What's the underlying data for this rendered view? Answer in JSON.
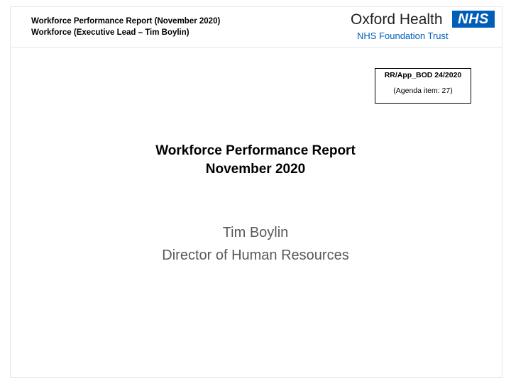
{
  "header": {
    "line1": "Workforce Performance Report (November 2020)",
    "line2": "Workforce (Executive Lead – Tim Boylin)"
  },
  "logo": {
    "organisation": "Oxford Health",
    "nhs_mark": "NHS",
    "trust": "NHS Foundation Trust",
    "brand_color": "#005eb8"
  },
  "reference": {
    "code": "RR/App_BOD 24/2020",
    "agenda": "(Agenda item: 27)"
  },
  "title": {
    "line1": "Workforce Performance Report",
    "line2": "November 2020"
  },
  "presenter": {
    "name": "Tim Boylin",
    "role": "Director of Human Resources"
  }
}
